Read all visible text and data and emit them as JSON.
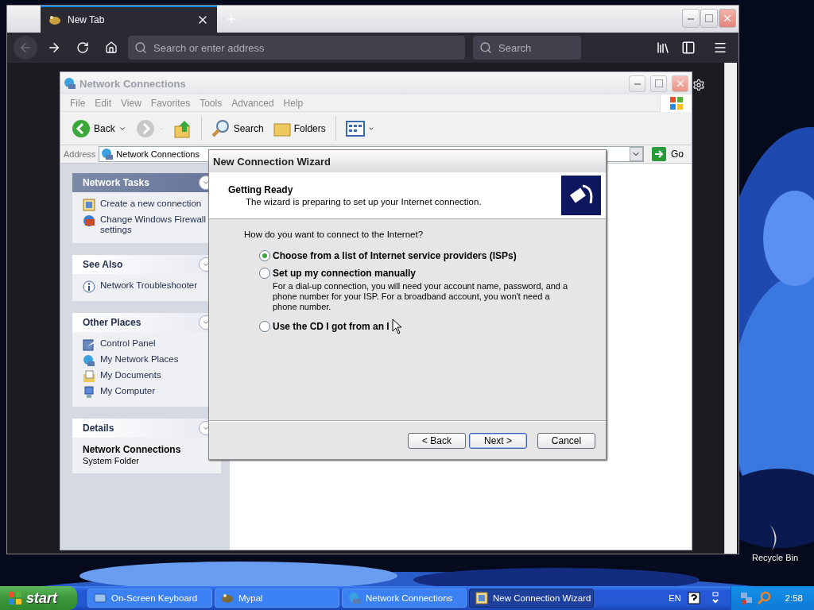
{
  "desktop": {
    "icons": [
      {
        "label": "Recycle Bin"
      }
    ]
  },
  "browser": {
    "tabs": [
      {
        "label": "New Tab",
        "selected": true
      }
    ],
    "back_disabled": true,
    "url_field": {
      "placeholder": "Search or enter address"
    },
    "search_field": {
      "placeholder": "Search"
    }
  },
  "explorer": {
    "title": "Network Connections",
    "menu": [
      "File",
      "Edit",
      "View",
      "Favorites",
      "Tools",
      "Advanced",
      "Help"
    ],
    "toolbar": [
      {
        "kind": "back",
        "label": "Back"
      },
      {
        "kind": "forward"
      },
      {
        "kind": "up"
      },
      {
        "kind": "search",
        "label": "Search"
      },
      {
        "kind": "folders",
        "label": "Folders"
      },
      {
        "kind": "views"
      }
    ],
    "address": {
      "label": "Address",
      "value": "Network Connections",
      "go": "Go"
    },
    "panels": [
      {
        "kind": "special",
        "title": "Network Tasks",
        "items": [
          {
            "kind": "wizard",
            "label": "Create a new connection"
          },
          {
            "kind": "firewall",
            "label": "Change Windows Firewall settings"
          }
        ]
      },
      {
        "kind": "normal",
        "title": "See Also",
        "items": [
          {
            "kind": "info",
            "label": "Network Troubleshooter"
          }
        ]
      },
      {
        "kind": "normal",
        "title": "Other Places",
        "items": [
          {
            "kind": "control",
            "label": "Control Panel"
          },
          {
            "kind": "network",
            "label": "My Network Places"
          },
          {
            "kind": "documents",
            "label": "My Documents"
          },
          {
            "kind": "computer",
            "label": "My Computer"
          }
        ]
      }
    ],
    "details": {
      "title": "Details",
      "name": "Network Connections",
      "type": "System Folder"
    }
  },
  "wizard": {
    "title": "New Connection Wizard",
    "heading": "Getting Ready",
    "subheading": "The wizard is preparing to set up your Internet connection.",
    "question": "How do you want to connect to the Internet?",
    "options": [
      {
        "label": "Choose from a list of Internet service providers (ISPs)",
        "selected": true
      },
      {
        "label": "Set up my connection manually",
        "selected": false,
        "description": "For a dial-up connection, you will need your account name, password, and a phone number for your ISP. For a broadband account, you won't need a phone number."
      },
      {
        "label": "Use the CD I got from an I",
        "selected": false
      }
    ],
    "buttons": [
      {
        "label": "< Back",
        "default": false
      },
      {
        "label": "Next >",
        "default": true
      },
      {
        "label": "Cancel",
        "default": false
      }
    ]
  },
  "taskbar": {
    "start": "start",
    "tasks": [
      {
        "kind": "keyboard",
        "label": "On-Screen Keyboard",
        "selected": false
      },
      {
        "kind": "mypal",
        "label": "Mypal",
        "selected": false
      },
      {
        "kind": "network",
        "label": "Network Connections",
        "selected": false
      },
      {
        "kind": "wizard",
        "label": "New Connection Wizard",
        "selected": true
      }
    ],
    "language": "EN",
    "clock": "2:58"
  }
}
